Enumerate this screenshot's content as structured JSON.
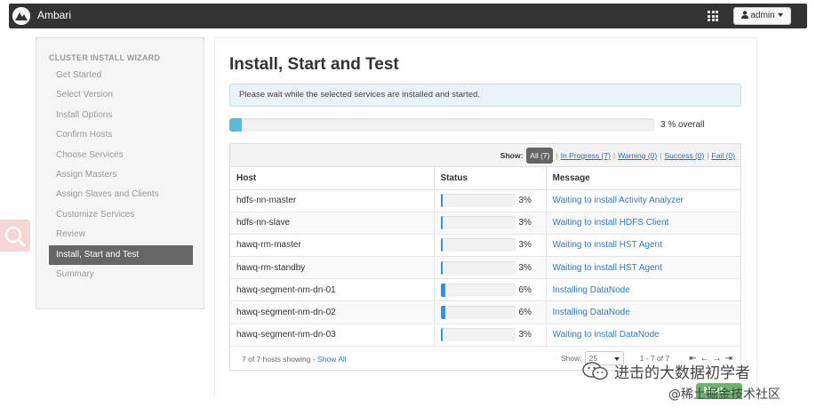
{
  "topbar": {
    "brand": "Ambari",
    "user_label": "admin"
  },
  "sidebar": {
    "title": "CLUSTER INSTALL WIZARD",
    "items": [
      {
        "label": "Get Started"
      },
      {
        "label": "Select Version"
      },
      {
        "label": "Install Options"
      },
      {
        "label": "Confirm Hosts"
      },
      {
        "label": "Choose Services"
      },
      {
        "label": "Assign Masters"
      },
      {
        "label": "Assign Slaves and Clients"
      },
      {
        "label": "Customize Services"
      },
      {
        "label": "Review"
      },
      {
        "label": "Install, Start and Test",
        "active": true
      },
      {
        "label": "Summary"
      }
    ]
  },
  "main": {
    "title": "Install, Start and Test",
    "alert": "Please wait while the selected services are installed and started.",
    "overall_progress": 0.03,
    "overall_label": "3 % overall",
    "filter": {
      "show_label": "Show:",
      "all": "All (7)",
      "in_progress": "In Progress (7)",
      "warning": "Warning (0)",
      "success": "Success (0)",
      "fail": "Fail (0)"
    },
    "table": {
      "headers": {
        "host": "Host",
        "status": "Status",
        "message": "Message"
      },
      "rows": [
        {
          "host": "hdfs-nn-master",
          "progress": 0.03,
          "pct": "3%",
          "message": "Waiting to install Activity Analyzer"
        },
        {
          "host": "hdfs-nn-slave",
          "progress": 0.03,
          "pct": "3%",
          "message": "Waiting to install HDFS Client"
        },
        {
          "host": "hawq-rm-master",
          "progress": 0.03,
          "pct": "3%",
          "message": "Waiting to install HST Agent"
        },
        {
          "host": "hawq-rm-standby",
          "progress": 0.03,
          "pct": "3%",
          "message": "Waiting to install HST Agent"
        },
        {
          "host": "hawq-segment-nm-dn-01",
          "progress": 0.06,
          "pct": "6%",
          "message": "Installing DataNode"
        },
        {
          "host": "hawq-segment-nm-dn-02",
          "progress": 0.06,
          "pct": "6%",
          "message": "Installing DataNode"
        },
        {
          "host": "hawq-segment-nm-dn-03",
          "progress": 0.03,
          "pct": "3%",
          "message": "Waiting to install DataNode"
        }
      ]
    },
    "footer": {
      "showing": "7 of 7 hosts showing - ",
      "show_all": "Show All",
      "show_label": "Show:",
      "page_size": "25",
      "range": "1 - 7 of 7"
    },
    "next_button": "Next →"
  },
  "watermark": {
    "line1": "进击的大数据初学者",
    "line2": "@稀土掘金技术社区"
  },
  "colors": {
    "accent": "#5ab8d9",
    "bar": "#3a8fd6",
    "link": "#2a7bc6",
    "next": "#6ab56a"
  }
}
